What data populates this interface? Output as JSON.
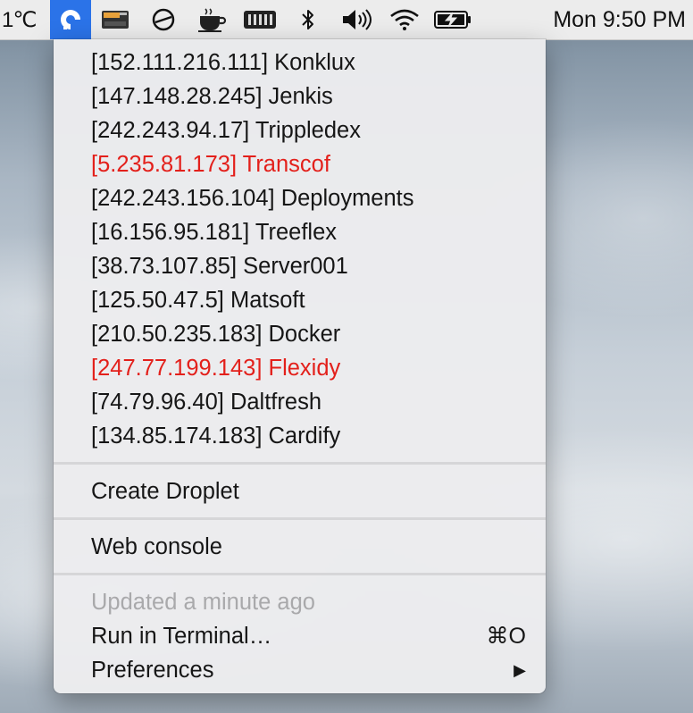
{
  "menubar": {
    "temperature": "1℃",
    "clock": "Mon 9:50 PM",
    "icons": [
      "digitalocean-icon",
      "drive-icon",
      "circle-slash-icon",
      "coffee-cup-icon",
      "memory-icon",
      "bluetooth-icon",
      "volume-icon",
      "wifi-icon",
      "battery-charging-icon"
    ]
  },
  "menu": {
    "droplets": [
      {
        "label": "[152.111.216.111] Konklux",
        "alert": false
      },
      {
        "label": "[147.148.28.245] Jenkis",
        "alert": false
      },
      {
        "label": "[242.243.94.17] Trippledex",
        "alert": false
      },
      {
        "label": "[5.235.81.173] Transcof",
        "alert": true
      },
      {
        "label": "[242.243.156.104] Deployments",
        "alert": false
      },
      {
        "label": "[16.156.95.181] Treeflex",
        "alert": false
      },
      {
        "label": "[38.73.107.85] Server001",
        "alert": false
      },
      {
        "label": "[125.50.47.5] Matsoft",
        "alert": false
      },
      {
        "label": "[210.50.235.183] Docker",
        "alert": false
      },
      {
        "label": "[247.77.199.143] Flexidy",
        "alert": true
      },
      {
        "label": "[74.79.96.40] Daltfresh",
        "alert": false
      },
      {
        "label": "[134.85.174.183] Cardify",
        "alert": false
      }
    ],
    "create_droplet": "Create Droplet",
    "web_console": "Web console",
    "updated": "Updated a minute ago",
    "run_in_terminal": "Run in Terminal…",
    "run_shortcut": "⌘O",
    "preferences": "Preferences",
    "preferences_arrow": "▶"
  },
  "colors": {
    "alert": "#e3201b",
    "selected_icon_bg": "#2b73e8"
  }
}
